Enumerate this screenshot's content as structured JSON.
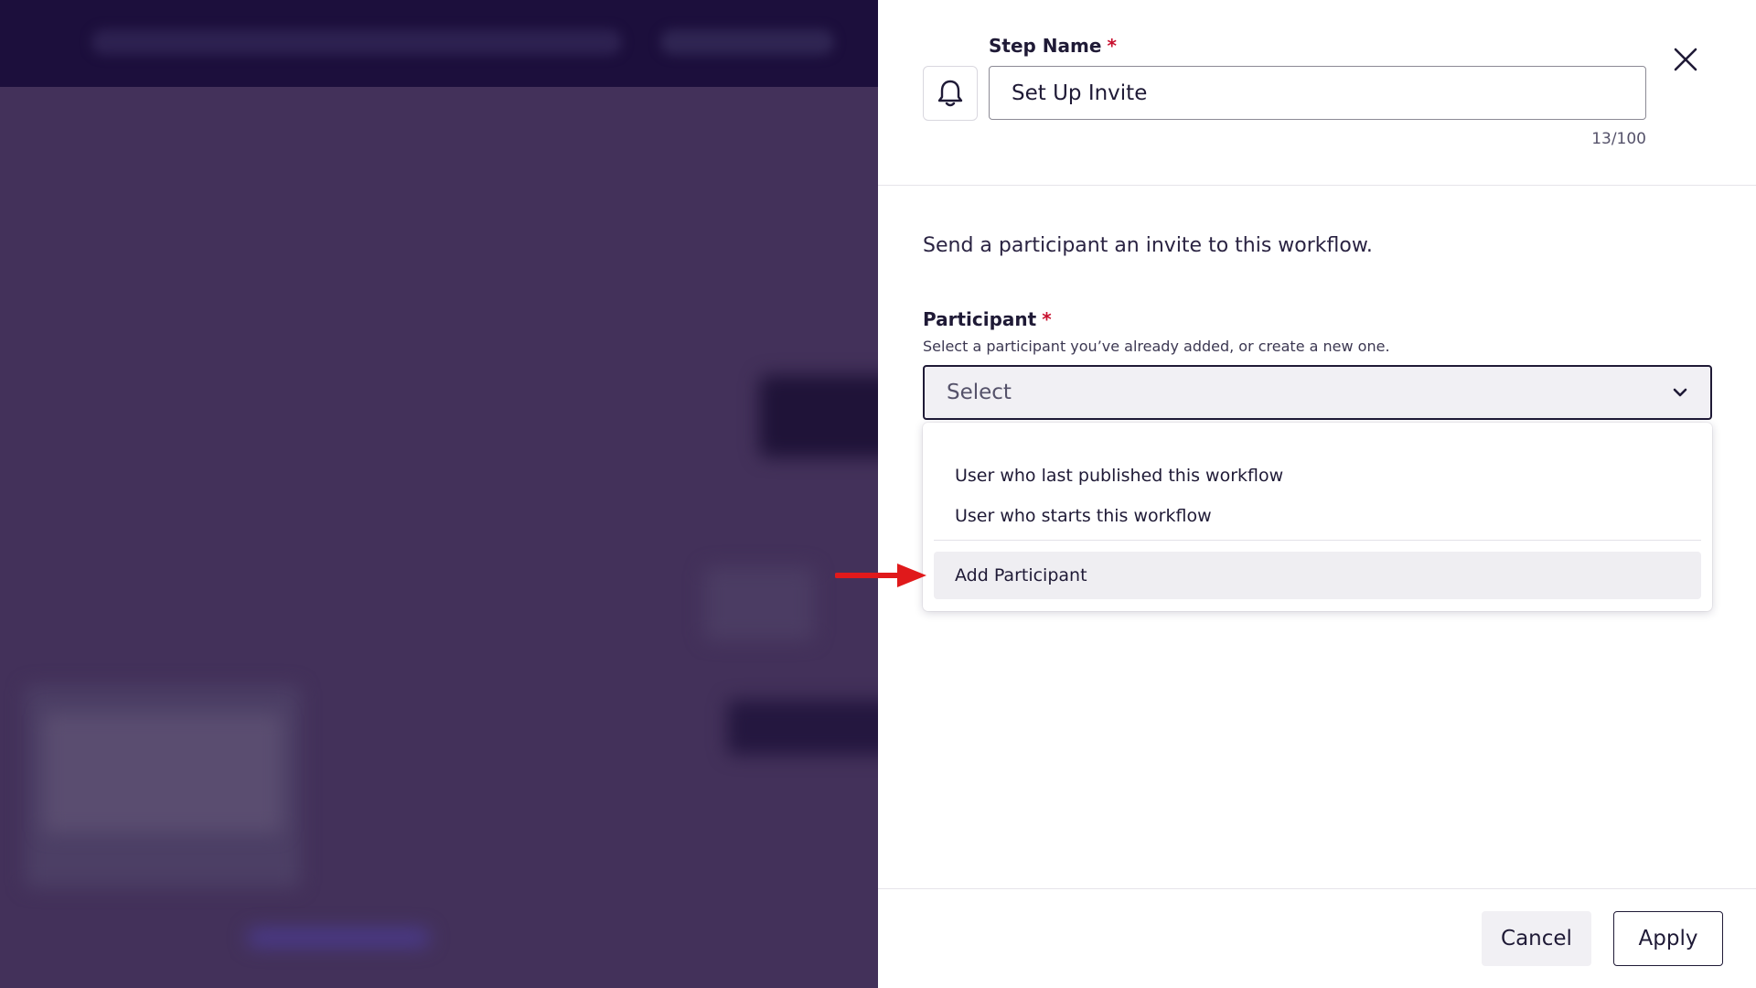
{
  "step": {
    "label": "Step Name",
    "required_mark": "*",
    "value": "Set Up Invite",
    "counter": "13/100",
    "icon": "bell-icon"
  },
  "description": "Send a participant an invite to this workflow.",
  "participant": {
    "label": "Participant",
    "required_mark": "*",
    "help": "Select a participant you’ve already added, or create a new one.",
    "select_placeholder": "Select",
    "options": [
      {
        "label": "User who last published this workflow"
      },
      {
        "label": "User who starts this workflow"
      },
      {
        "label": "Add Participant"
      }
    ]
  },
  "footer": {
    "cancel": "Cancel",
    "apply": "Apply"
  },
  "colors": {
    "backdrop": "#43315a",
    "header": "#1c0f3c",
    "required": "#c8102e",
    "arrow": "#e0191b"
  }
}
